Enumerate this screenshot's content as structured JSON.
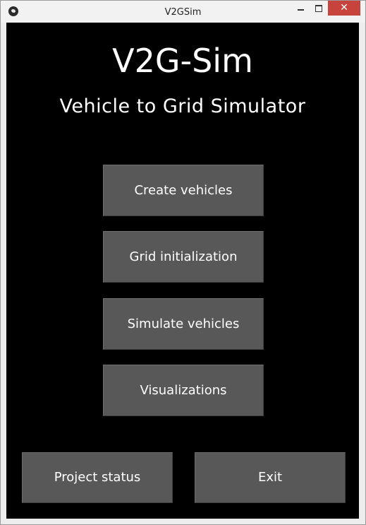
{
  "window": {
    "title": "V2GSim",
    "icon": "kivy-app-icon",
    "controls": {
      "minimize": "minimize-icon",
      "maximize": "maximize-icon",
      "close": "close-icon",
      "close_glyph": "✕",
      "close_color": "#c7443c"
    }
  },
  "header": {
    "title": "V2G-Sim",
    "subtitle": "Vehicle to Grid Simulator"
  },
  "menu": {
    "create_vehicles": "Create vehicles",
    "grid_initialization": "Grid initialization",
    "simulate_vehicles": "Simulate vehicles",
    "visualizations": "Visualizations"
  },
  "footer": {
    "project_status": "Project status",
    "exit": "Exit"
  },
  "colors": {
    "background": "#000000",
    "button": "#585858",
    "text": "#ffffff"
  }
}
